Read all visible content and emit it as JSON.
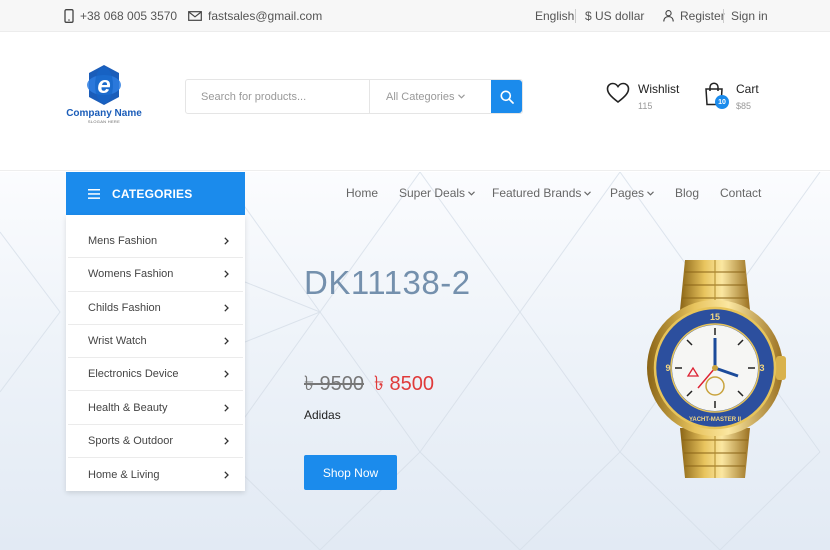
{
  "topbar": {
    "phone": "+38 068 005 3570",
    "email": "fastsales@gmail.com",
    "language": "English",
    "currency": "$ US dollar",
    "register": "Register",
    "signin": "Sign in"
  },
  "header": {
    "company_name": "Company Name",
    "slogan": "SLOGAN HERE",
    "logo_letter": "e",
    "search_placeholder": "Search for products...",
    "search_category": "All Categories",
    "wishlist": {
      "label": "Wishlist",
      "count": "115"
    },
    "cart": {
      "label": "Cart",
      "amount": "$85",
      "badge": "10"
    }
  },
  "categories": {
    "title": "CATEGORIES",
    "items": [
      "Mens Fashion",
      "Womens Fashion",
      "Childs Fashion",
      "Wrist Watch",
      "Electronics Device",
      "Health & Beauty",
      "Sports & Outdoor",
      "Home & Living"
    ]
  },
  "nav": {
    "items": [
      {
        "label": "Home"
      },
      {
        "label": "Super Deals"
      },
      {
        "label": "Featured Brands"
      },
      {
        "label": "Pages"
      },
      {
        "label": "Blog"
      },
      {
        "label": "Contact"
      }
    ]
  },
  "hero": {
    "product_name": "DK11138-2",
    "old_price": "৳ 9500",
    "new_price": "৳ 8500",
    "brand": "Adidas",
    "button": "Shop Now",
    "watch_dial_text": "YACHT-MASTER II"
  },
  "colors": {
    "accent": "#1b8bec",
    "sale": "#e03a3a",
    "product_title": "#7490ad"
  },
  "icons": [
    "phone-icon",
    "mail-icon",
    "user-icon",
    "search-icon",
    "chevron-down-icon",
    "heart-icon",
    "bag-icon",
    "menu-icon",
    "chevron-right-icon"
  ]
}
